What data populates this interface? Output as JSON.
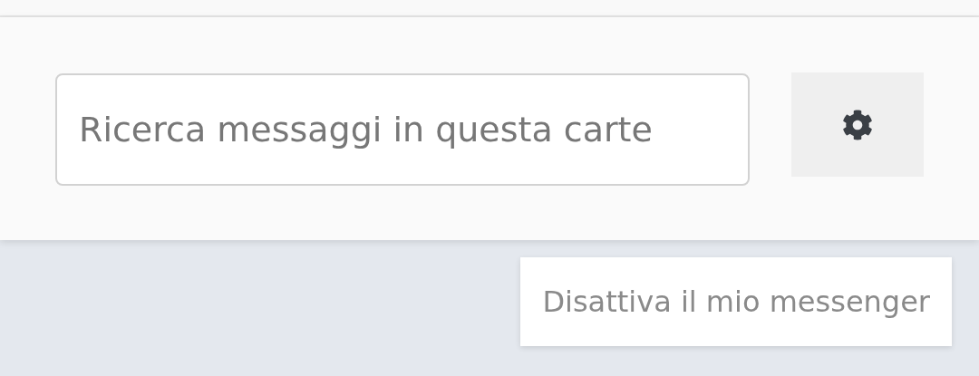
{
  "search": {
    "placeholder": "Ricerca messaggi in questa carte"
  },
  "menu": {
    "items": [
      {
        "label": "Disattiva il mio messenger"
      }
    ]
  }
}
